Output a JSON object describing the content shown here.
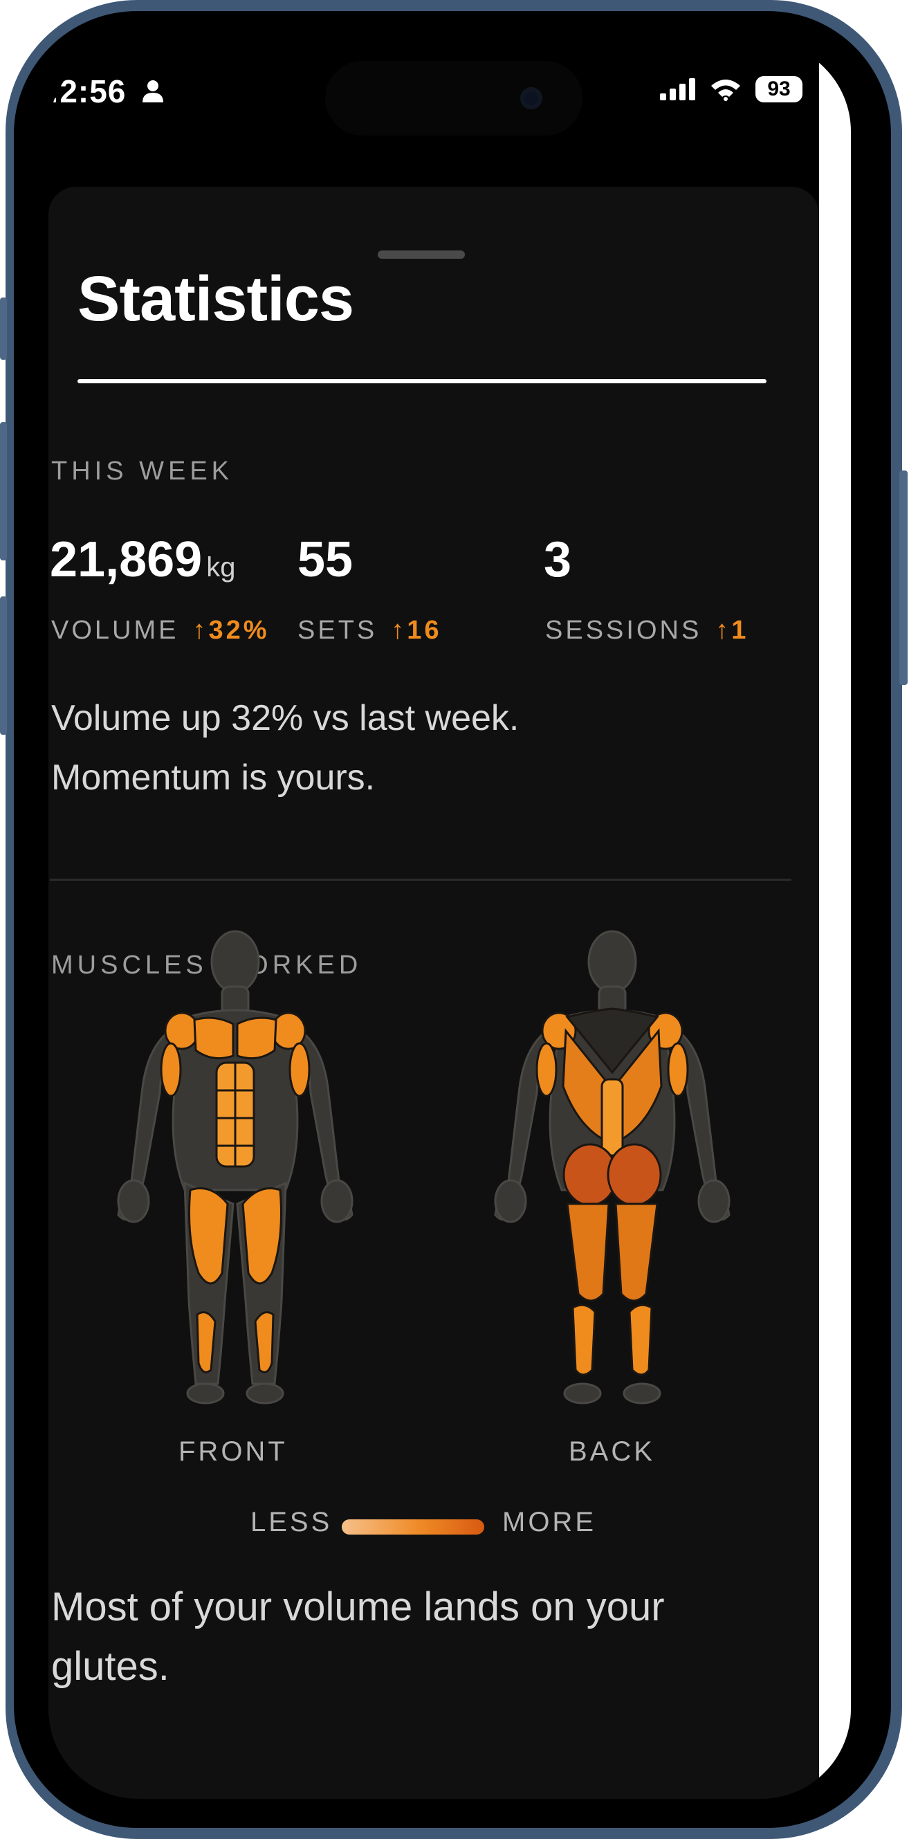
{
  "status": {
    "time": ":2:56",
    "battery": "93"
  },
  "title": "Statistics",
  "this_week": {
    "label": "THIS WEEK",
    "volume": {
      "value": "21,869",
      "unit": "kg",
      "label": "VOLUME",
      "delta": "↑32%"
    },
    "sets": {
      "value": "55",
      "label": "SETS",
      "delta": "↑16"
    },
    "sessions": {
      "value": "3",
      "label": "SESSIONS",
      "delta": "↑1"
    },
    "summary_line1": "Volume up 32% vs last week.",
    "summary_line2": "Momentum is yours."
  },
  "muscles": {
    "label": "MUSCLES WORKED",
    "front_label": "FRONT",
    "back_label": "BACK",
    "legend_less": "LESS",
    "legend_more": "MORE",
    "insight": "Most of your volume lands on your glutes."
  },
  "colors": {
    "accent": "#f08c1e",
    "sheet": "#101010",
    "frame": "#3f5876"
  }
}
